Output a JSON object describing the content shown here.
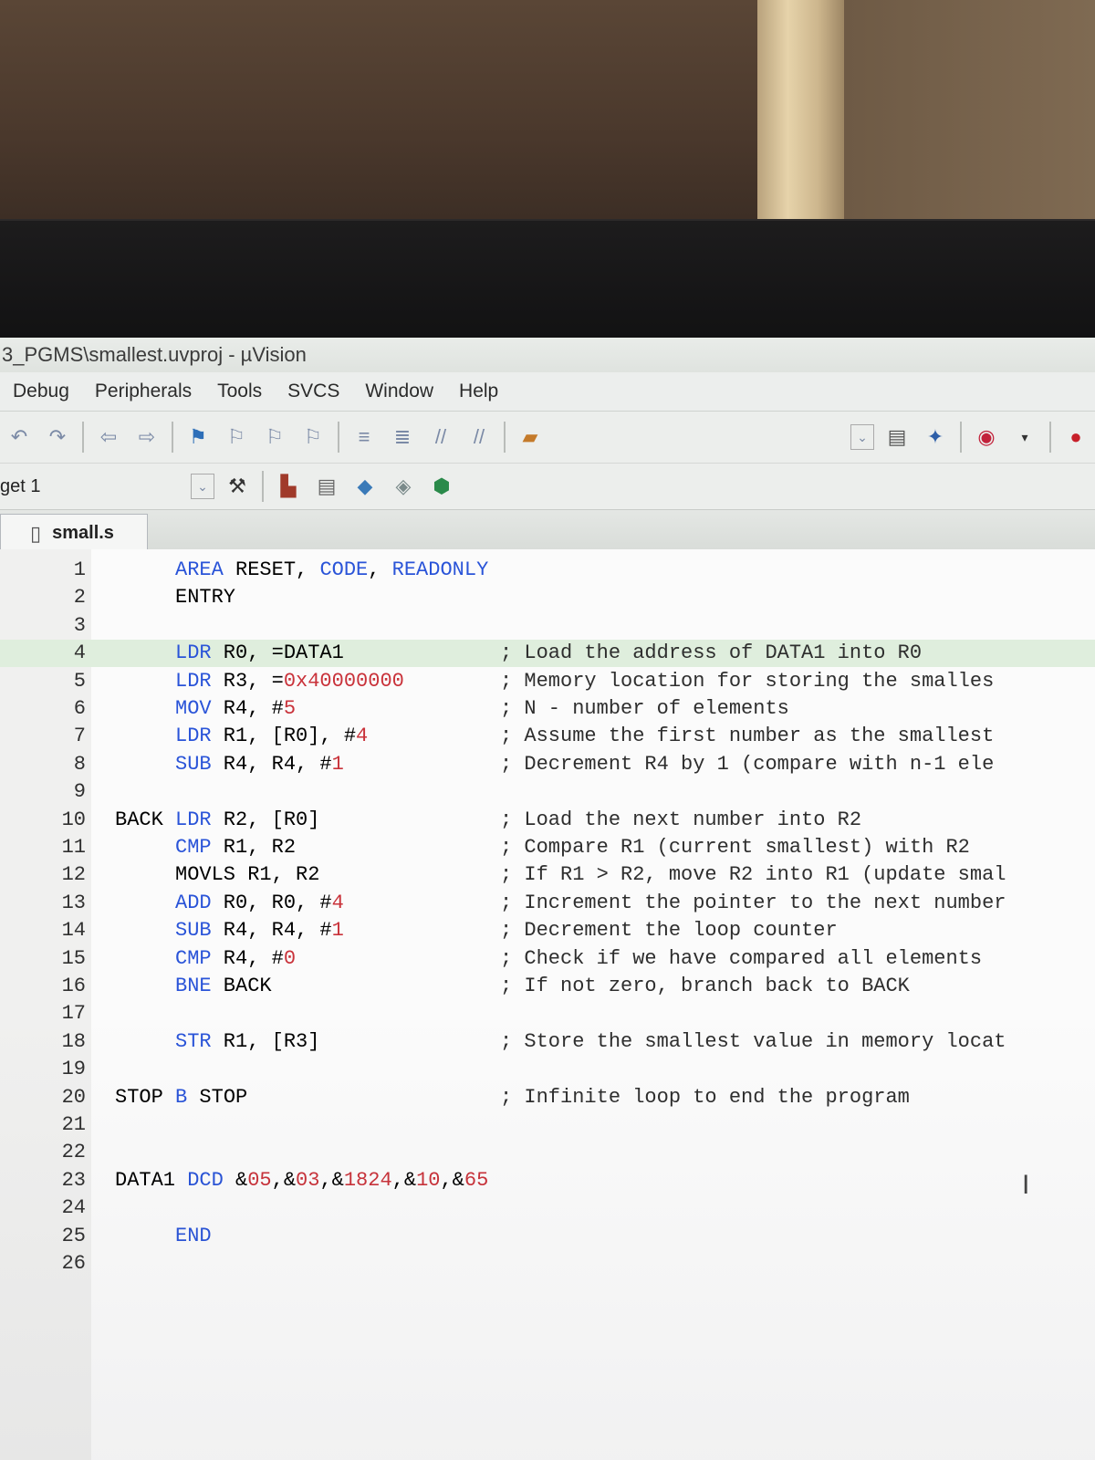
{
  "window": {
    "title": "3_PGMS\\smallest.uvproj - µVision"
  },
  "menu": [
    "Debug",
    "Peripherals",
    "Tools",
    "SVCS",
    "Window",
    "Help"
  ],
  "target": {
    "label": "get 1"
  },
  "tab": {
    "label": "small.s"
  },
  "editor": {
    "lines": [
      {
        "n": "1",
        "code": "AREA RESET, CODE, READONLY",
        "comment": ""
      },
      {
        "n": "2",
        "code": "ENTRY",
        "comment": ""
      },
      {
        "n": "3",
        "code": "",
        "comment": ""
      },
      {
        "n": "4",
        "code": "LDR R0, =DATA1",
        "comment": "; Load the address of DATA1 into R0"
      },
      {
        "n": "5",
        "code": "LDR R3, =0x40000000",
        "comment": "; Memory location for storing the smalles"
      },
      {
        "n": "6",
        "code": "MOV R4, #5",
        "comment": "; N - number of elements"
      },
      {
        "n": "7",
        "code": "LDR R1, [R0], #4",
        "comment": "; Assume the first number as the smallest"
      },
      {
        "n": "8",
        "code": "SUB R4, R4, #1",
        "comment": "; Decrement R4 by 1 (compare with n-1 ele"
      },
      {
        "n": "9",
        "code": "",
        "comment": ""
      },
      {
        "n": "10",
        "code": "BACK LDR R2, [R0]",
        "comment": "; Load the next number into R2"
      },
      {
        "n": "11",
        "code": "CMP R1, R2",
        "comment": "; Compare R1 (current smallest) with R2"
      },
      {
        "n": "12",
        "code": "MOVLS R1, R2",
        "comment": "; If R1 > R2, move R2 into R1 (update smal"
      },
      {
        "n": "13",
        "code": "ADD R0, R0, #4",
        "comment": "; Increment the pointer to the next number"
      },
      {
        "n": "14",
        "code": "SUB R4, R4, #1",
        "comment": "; Decrement the loop counter"
      },
      {
        "n": "15",
        "code": "CMP R4, #0",
        "comment": "; Check if we have compared all elements"
      },
      {
        "n": "16",
        "code": "BNE BACK",
        "comment": "; If not zero, branch back to BACK"
      },
      {
        "n": "17",
        "code": "",
        "comment": ""
      },
      {
        "n": "18",
        "code": "STR R1, [R3]",
        "comment": "; Store the smallest value in memory locat"
      },
      {
        "n": "19",
        "code": "",
        "comment": ""
      },
      {
        "n": "20",
        "code": "STOP B STOP",
        "comment": "; Infinite loop to end the program"
      },
      {
        "n": "21",
        "code": "",
        "comment": ""
      },
      {
        "n": "22",
        "code": "",
        "comment": ""
      },
      {
        "n": "23",
        "code": "DATA1 DCD &05,&03,&1824,&10,&65",
        "comment": ""
      },
      {
        "n": "24",
        "code": "",
        "comment": ""
      },
      {
        "n": "25",
        "code": "END",
        "comment": ""
      },
      {
        "n": "26",
        "code": "",
        "comment": ""
      }
    ]
  },
  "colors": {
    "keyword": "#2a54d8",
    "number": "#c9323a",
    "highlight": "#dfeedd"
  }
}
